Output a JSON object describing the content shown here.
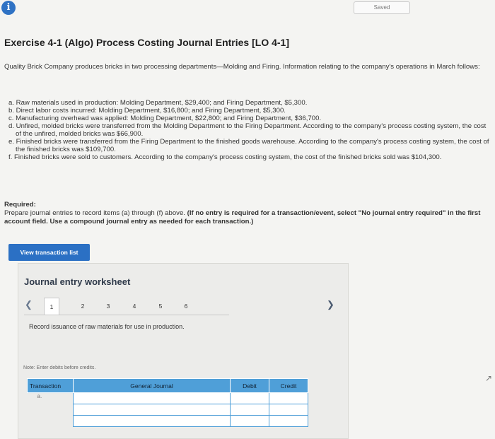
{
  "header": {
    "info_icon": "i",
    "saved_label": "Saved"
  },
  "exercise": {
    "title": "Exercise 4-1 (Algo) Process Costing Journal Entries [LO 4-1]",
    "intro": "Quality Brick Company produces bricks in two processing departments—Molding and Firing. Information relating to the company's operations in March follows:",
    "items": [
      "a. Raw materials used in production: Molding Department, $29,400; and Firing Department, $5,300.",
      "b. Direct labor costs incurred: Molding Department, $16,800; and Firing Department, $5,300.",
      "c. Manufacturing overhead was applied: Molding Department, $22,800; and Firing Department, $36,700.",
      "d. Unfired, molded bricks were transferred from the Molding Department to the Firing Department. According to the company's process costing system, the cost of the unfired, molded bricks was $66,900.",
      "e. Finished bricks were transferred from the Firing Department to the finished goods warehouse. According to the company's process costing system, the cost of the finished bricks was $109,700.",
      "f. Finished bricks were sold to customers. According to the company's process costing system, the cost of the finished bricks sold was $104,300."
    ],
    "required_heading": "Required:",
    "required_text": "Prepare journal entries to record items (a) through (f) above.",
    "required_bold": "(If no entry is required for a transaction/event, select \"No journal entry required\" in the first account field. Use a compound journal entry as needed for each transaction.)"
  },
  "buttons": {
    "view_transaction_list": "View transaction list"
  },
  "worksheet": {
    "title": "Journal entry worksheet",
    "pages": [
      "1",
      "2",
      "3",
      "4",
      "5",
      "6"
    ],
    "active_page": "1",
    "instruction": "Record issuance of raw materials for use in production.",
    "note": "Note: Enter debits before credits.",
    "columns": {
      "transaction": "Transaction",
      "general_journal": "General Journal",
      "debit": "Debit",
      "credit": "Credit"
    },
    "transaction_value": "a."
  }
}
